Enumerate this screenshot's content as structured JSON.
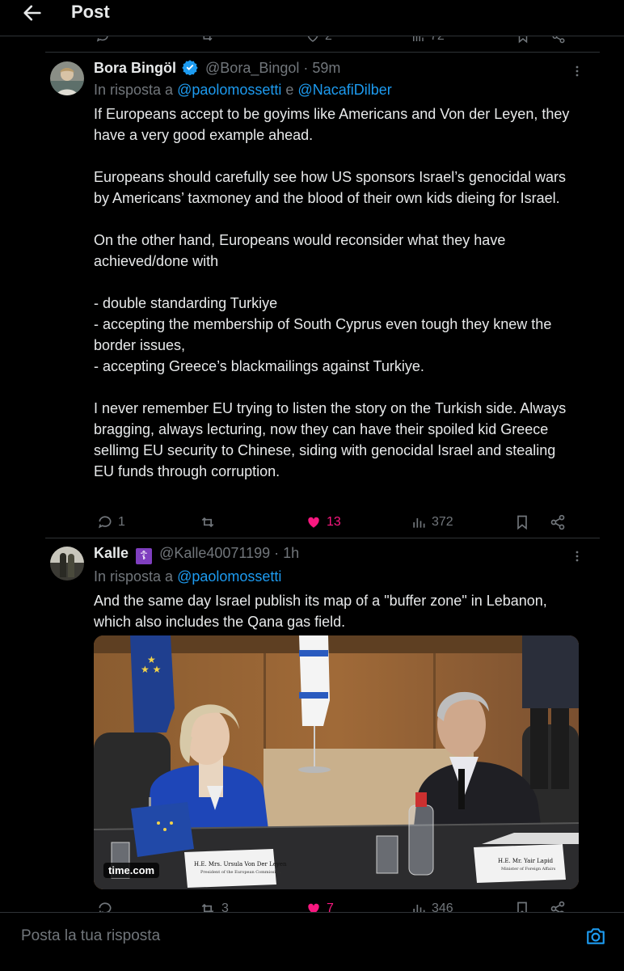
{
  "header": {
    "title": "Post"
  },
  "partial_row": {
    "likes": "2",
    "views": "72"
  },
  "tweets": [
    {
      "name": "Bora Bingöl",
      "handle": "@Bora_Bingol",
      "time": "· 59m",
      "reply_prefix": "In risposta a ",
      "reply_user1": "@paolomossetti",
      "reply_joiner": " e ",
      "reply_user2": "@NacafiDilber",
      "text": "If Europeans accept to be goyims like Americans and Von der Leyen, they have a very good example ahead.\n\nEuropeans should carefully see how US sponsors Israel’s genocidal wars by Americans’ taxmoney and the blood of their own kids dieing for Israel.\n\nOn the other hand, Europeans would reconsider what they have achieved/done with\n\n- double standarding Turkiye\n- accepting the membership of South Cyprus even tough they knew the border issues,\n- accepting Greece’s blackmailings against Turkiye.\n\nI never remember EU trying to listen the story on the Turkish side. Always bragging, always lecturing, now they can have their spoiled kid Greece sellimg EU security to Chinese, siding with genocidal Israel and stealing EU funds through corruption.",
      "replies": "1",
      "reposts": "",
      "likes": "13",
      "views": "372"
    },
    {
      "name": "Kalle",
      "badge": "☦",
      "handle": "@Kalle40071199",
      "time": "· 1h",
      "reply_prefix": "In risposta a ",
      "reply_user1": "@paolomossetti",
      "text": "And the same day Israel publish its map of a \"buffer zone\" in Lebanon, which also includes the Qana gas field.",
      "media_source": "time.com",
      "placard_left_name": "H.E. Mrs. Ursula Von Der Leyen",
      "placard_left_title": "President of the European Commission",
      "placard_right_name": "H.E. Mr. Yair Lapid",
      "placard_right_title": "Minister of Foreign Affairs",
      "replies": "",
      "reposts": "3",
      "likes": "7",
      "views": "346"
    }
  ],
  "reply_bar": {
    "placeholder": "Posta la tua risposta"
  },
  "colors": {
    "background": "#000000",
    "text": "#e7e9ea",
    "muted": "#71767b",
    "link": "#1d9bf0",
    "like": "#f91880",
    "divider": "#2f3336"
  }
}
